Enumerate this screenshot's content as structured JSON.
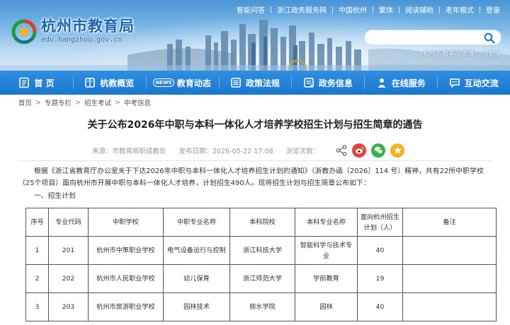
{
  "top_links": [
    "智能问答",
    "浙江政务服务网",
    "中国杭州",
    "繁体",
    "阅读辅助",
    "老年模式",
    "登录"
  ],
  "site": {
    "title": "杭州市教育局",
    "domain": "edu.hangzhou.gov.cn",
    "weibo": "杭州市教育局微博：  @新浪"
  },
  "search": {
    "placeholder": "",
    "value": ""
  },
  "nav": [
    {
      "label": "首 页",
      "icon": "home-icon"
    },
    {
      "label": "杭教概览",
      "icon": "book-icon"
    },
    {
      "label": "教育动态",
      "icon": "news-icon",
      "badge": "NEWS"
    },
    {
      "label": "政策法规",
      "icon": "law-icon"
    },
    {
      "label": "政务信息",
      "icon": "info-icon"
    },
    {
      "label": "在线服务",
      "icon": "user-icon"
    },
    {
      "label": "互动交流",
      "icon": "chat-icon"
    }
  ],
  "breadcrumb": [
    "首页",
    "专题专栏",
    "招生考试",
    "中考信息"
  ],
  "article": {
    "title": "关于公布2026年中职与本科一体化人才培养学校招生计划与招生简章的通告",
    "source": "来源：市教育局职成教处",
    "date": "发布日期：2026-05-22 17:08",
    "views": "浏览次数：",
    "paragraph": "根据《浙江省教育厅办公室关于下达2026年中职与本科一体化人才培养招生计划的通知》（浙教办函〔2026〕114 号）精神，共有22所中职学校（25个项目）面向杭州市开展中职与本科一体化人才培养，计划招生490人。现将招生计划与招生简章公布如下：",
    "section": "一、招生计划"
  },
  "share_icons": [
    "share-icon",
    "weibo-icon",
    "wechat-icon",
    "favorite-icon"
  ],
  "colors": {
    "nav": "#1a76cf",
    "weibo": "#e5403a",
    "wechat": "#36b24a",
    "favorite": "#f4b21c"
  },
  "table": {
    "headers": [
      "序号",
      "专业代码",
      "中职学校",
      "中职专业名称",
      "本科院校",
      "本科专业名称",
      "面向杭州招生计划（人）",
      "备注"
    ],
    "rows": [
      [
        "1",
        "201",
        "杭州市中策职业学校",
        "电气设备运行与控制",
        "浙江科技大学",
        "智能科学与技术专业",
        "40",
        ""
      ],
      [
        "2",
        "202",
        "杭州市人民职业学校",
        "幼儿保育",
        "浙江师范大学",
        "学前教育",
        "19",
        ""
      ],
      [
        "3",
        "203",
        "杭州市旅游职业学校",
        "园林技术",
        "丽水学院",
        "园林",
        "40",
        ""
      ]
    ]
  }
}
